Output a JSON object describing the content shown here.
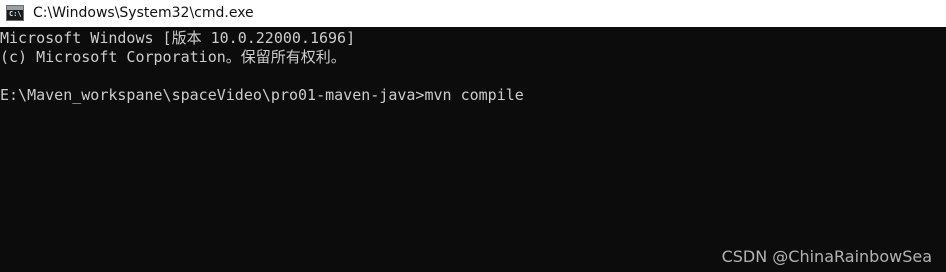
{
  "window": {
    "title": "C:\\Windows\\System32\\cmd.exe",
    "icon": "cmd-icon",
    "icon_glyph": "C:\\"
  },
  "console": {
    "lines": [
      "Microsoft Windows [版本 10.0.22000.1696]",
      "(c) Microsoft Corporation。保留所有权利。",
      ""
    ],
    "prompt": "E:\\Maven_workspane\\spaceVideo\\pro01-maven-java>",
    "command": "mvn compile"
  },
  "watermark": "CSDN @ChinaRainbowSea",
  "colors": {
    "background": "#0c0c0c",
    "text": "#cccccc",
    "titlebar": "#ffffff"
  }
}
